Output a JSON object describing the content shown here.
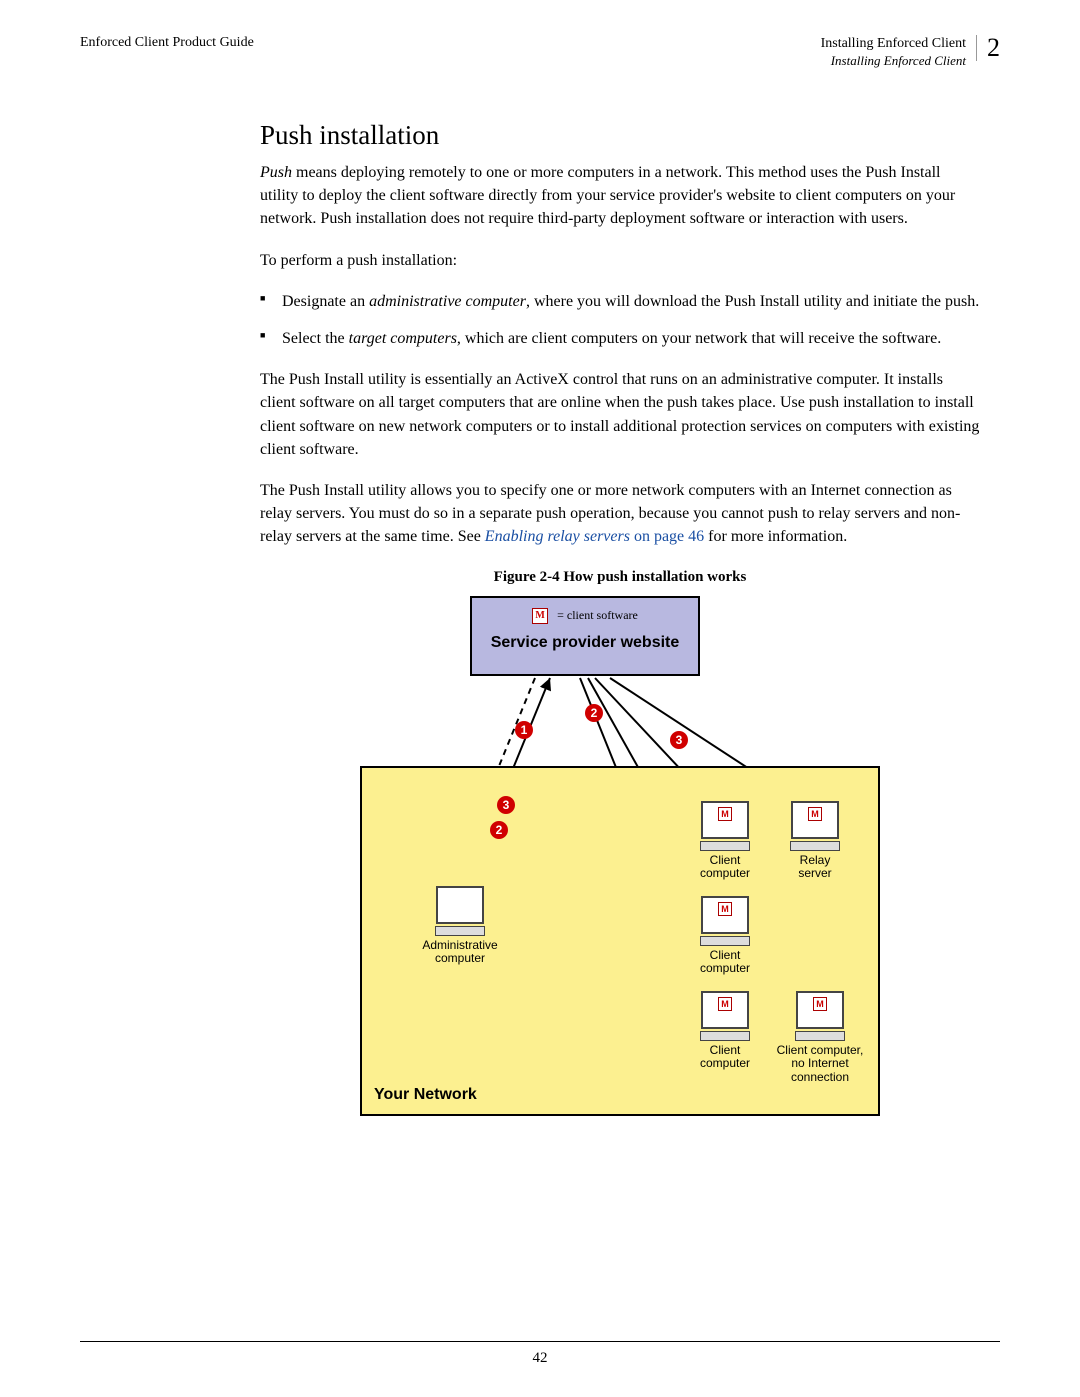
{
  "header": {
    "left": "Enforced Client Product Guide",
    "right_title": "Installing Enforced Client",
    "right_sub": "Installing Enforced Client",
    "chapter_num": "2"
  },
  "heading": "Push installation",
  "p1_lead": "Push",
  "p1_rest": " means deploying remotely to one or more computers in a network. This method uses the Push Install utility to deploy the client software directly from your service provider's website to client computers on your network. Push installation does not require third-party deployment software or interaction with users.",
  "p2": "To perform a push installation:",
  "bullets": [
    {
      "pre": "Designate an ",
      "em": "administrative computer",
      "post": ", where you will download the Push Install utility and initiate the push."
    },
    {
      "pre": "Select the ",
      "em": "target computers",
      "post": ", which are client computers on your network that will receive the software."
    }
  ],
  "p3": "The Push Install utility is essentially an ActiveX control that runs on an administrative computer. It installs client software on all target computers that are online when the push takes place. Use push installation to install client software on new network computers or to install additional protection services on computers with existing client software.",
  "p4_a": "The Push Install utility allows you to specify one or more network computers with an Internet connection as relay servers. You must do so in a separate push operation, because you cannot push to relay servers and non-relay servers at the same time. See ",
  "p4_link": "Enabling relay servers",
  "p4_on": " on page 46",
  "p4_b": " for more information.",
  "figure_caption": "Figure 2-4  How push installation works",
  "diagram": {
    "legend_icon_text": "M",
    "legend_text": "= client software",
    "spw_title": "Service provider website",
    "yn_title": "Your Network",
    "nodes": {
      "admin": "Administrative\ncomputer",
      "client1": "Client\ncomputer",
      "relay": "Relay\nserver",
      "client2": "Client\ncomputer",
      "client3": "Client\ncomputer",
      "noinet": "Client computer,\nno Internet\nconnection"
    },
    "badges": {
      "b1": "1",
      "b2": "2",
      "b3": "3",
      "b3b": "3",
      "b2b": "2"
    }
  },
  "page_number": "42"
}
